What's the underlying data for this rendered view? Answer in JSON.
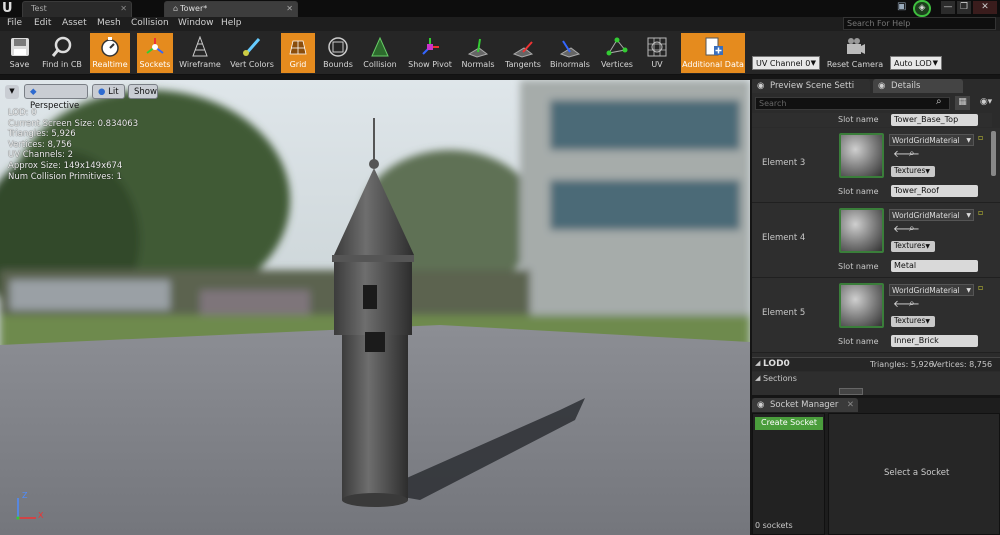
{
  "titlebar": {
    "logo": "U",
    "tabs": [
      {
        "label": "Test"
      },
      {
        "label": "Tower*"
      }
    ],
    "window_buttons": [
      "—",
      "❐",
      "✕"
    ]
  },
  "menubar": {
    "items": [
      "File",
      "Edit",
      "Asset",
      "Mesh",
      "Collision",
      "Window",
      "Help"
    ],
    "search_placeholder": "Search For Help"
  },
  "toolbar": {
    "buttons": [
      {
        "label": "Save",
        "icon": "save-icon",
        "active": false
      },
      {
        "label": "Find in CB",
        "icon": "magnifier-icon",
        "active": false
      },
      {
        "label": "Realtime",
        "icon": "stopwatch-icon",
        "active": true
      },
      {
        "label": "Sockets",
        "icon": "sockets-icon",
        "active": true
      },
      {
        "label": "Wireframe",
        "icon": "wireframe-icon",
        "active": false
      },
      {
        "label": "Vert Colors",
        "icon": "brush-icon",
        "active": false
      },
      {
        "label": "Grid",
        "icon": "grid-icon",
        "active": true
      },
      {
        "label": "Bounds",
        "icon": "bounds-icon",
        "active": false
      },
      {
        "label": "Collision",
        "icon": "collision-icon",
        "active": false
      },
      {
        "label": "Show Pivot",
        "icon": "pivot-icon",
        "active": false
      },
      {
        "label": "Normals",
        "icon": "normals-icon",
        "active": false
      },
      {
        "label": "Tangents",
        "icon": "tangents-icon",
        "active": false
      },
      {
        "label": "Binormals",
        "icon": "binormals-icon",
        "active": false
      },
      {
        "label": "Vertices",
        "icon": "vertices-icon",
        "active": false
      },
      {
        "label": "UV",
        "icon": "uv-icon",
        "active": false
      },
      {
        "label": "Additional Data",
        "icon": "additional-data-icon",
        "active": true
      }
    ],
    "uv_channel": "UV Channel 0",
    "reset_camera": "Reset Camera",
    "lod": "Auto LOD"
  },
  "viewport": {
    "perspective": "Perspective",
    "lit": "Lit",
    "show": "Show",
    "stats": [
      "LOD:  0",
      "Current Screen Size:  0.834063",
      "Triangles:  5,926",
      "Vertices:  8,756",
      "UV Channels:  2",
      "Approx Size: 149x149x674",
      "Num Collision Primitives:  1"
    ],
    "axis": {
      "z": "Z",
      "x": "X"
    }
  },
  "details": {
    "tabs": [
      "Preview Scene Setti",
      "Details"
    ],
    "search_placeholder": "Search",
    "first_slot": {
      "label": "Slot name",
      "value": "Tower_Base_Top"
    },
    "elements": [
      {
        "label": "Element 3",
        "material": "WorldGridMaterial",
        "textures": "Textures",
        "slot_label": "Slot name",
        "slot": "Tower_Roof"
      },
      {
        "label": "Element 4",
        "material": "WorldGridMaterial",
        "textures": "Textures",
        "slot_label": "Slot name",
        "slot": "Metal"
      },
      {
        "label": "Element 5",
        "material": "WorldGridMaterial",
        "textures": "Textures",
        "slot_label": "Slot name",
        "slot": "Inner_Brick"
      }
    ],
    "lod": {
      "label": "LOD0",
      "triangles": "Triangles: 5,926",
      "vertices": "Vertices: 8,756",
      "sections": "Sections"
    }
  },
  "socket_manager": {
    "tab": "Socket Manager",
    "create": "Create Socket",
    "select": "Select a Socket",
    "count": "0 sockets"
  },
  "colors": {
    "accent": "#e58b1e",
    "create_button": "#4a9d3c",
    "material_border": "#3a7e3a"
  }
}
